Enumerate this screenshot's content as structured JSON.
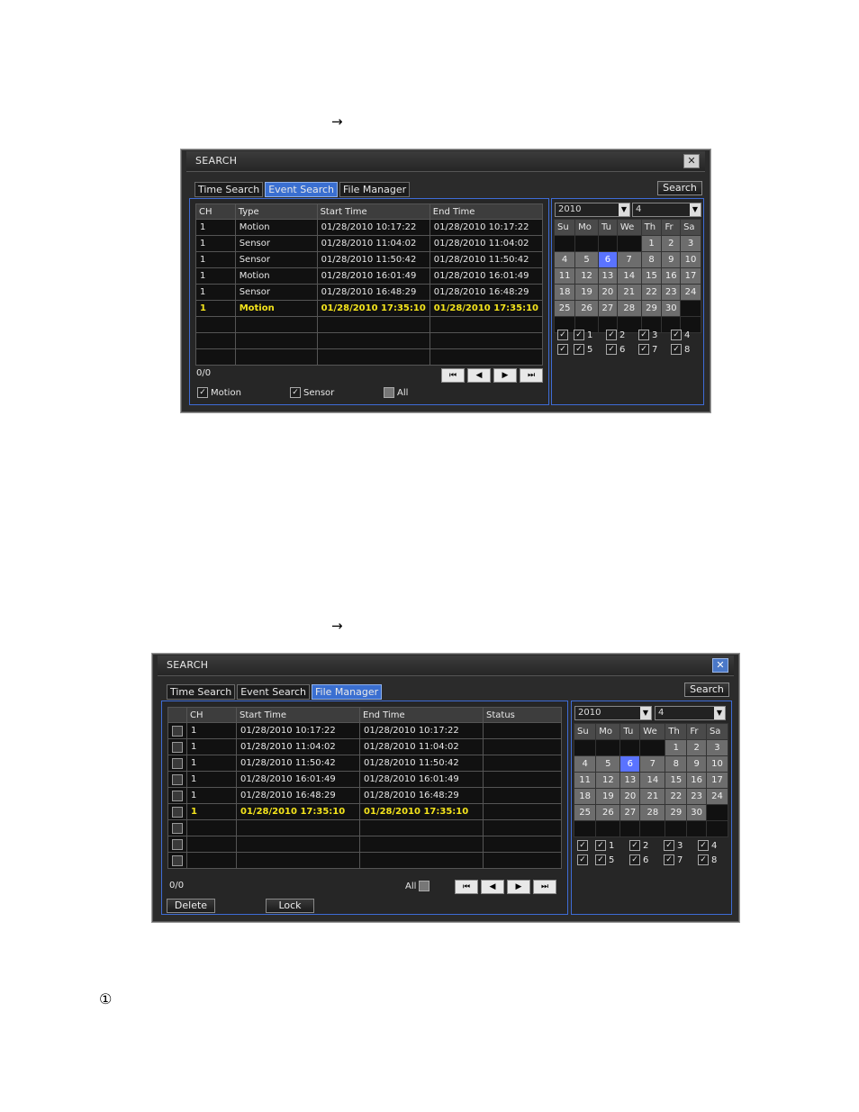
{
  "page": {
    "arrow_symbol": "→",
    "footnote_symbol": "①"
  },
  "event_window": {
    "title": "SEARCH",
    "close": "✕",
    "tabs": [
      "Time Search",
      "Event Search",
      "File Manager"
    ],
    "search_btn": "Search",
    "columns": [
      "CH",
      "Type",
      "Start Time",
      "End Time"
    ],
    "rows": [
      {
        "ch": "1",
        "type": "Motion",
        "start": "01/28/2010 10:17:22",
        "end": "01/28/2010 10:17:22"
      },
      {
        "ch": "1",
        "type": "Sensor",
        "start": "01/28/2010 11:04:02",
        "end": "01/28/2010 11:04:02"
      },
      {
        "ch": "1",
        "type": "Sensor",
        "start": "01/28/2010 11:50:42",
        "end": "01/28/2010 11:50:42"
      },
      {
        "ch": "1",
        "type": "Motion",
        "start": "01/28/2010 16:01:49",
        "end": "01/28/2010 16:01:49"
      },
      {
        "ch": "1",
        "type": "Sensor",
        "start": "01/28/2010 16:48:29",
        "end": "01/28/2010 16:48:29"
      },
      {
        "ch": "1",
        "type": "Motion",
        "start": "01/28/2010 17:35:10",
        "end": "01/28/2010 17:35:10"
      }
    ],
    "pager": "0/0",
    "filters": {
      "motion": "Motion",
      "sensor": "Sensor",
      "all": "All"
    },
    "year": "2010",
    "month": "4"
  },
  "file_window": {
    "title": "SEARCH",
    "close": "✕",
    "tabs": [
      "Time Search",
      "Event Search",
      "File Manager"
    ],
    "search_btn": "Search",
    "columns": [
      "CH",
      "Start Time",
      "End Time",
      "Status"
    ],
    "rows": [
      {
        "ch": "1",
        "start": "01/28/2010 10:17:22",
        "end": "01/28/2010 10:17:22"
      },
      {
        "ch": "1",
        "start": "01/28/2010 11:04:02",
        "end": "01/28/2010 11:04:02"
      },
      {
        "ch": "1",
        "start": "01/28/2010 11:50:42",
        "end": "01/28/2010 11:50:42"
      },
      {
        "ch": "1",
        "start": "01/28/2010 16:01:49",
        "end": "01/28/2010 16:01:49"
      },
      {
        "ch": "1",
        "start": "01/28/2010 16:48:29",
        "end": "01/28/2010 16:48:29"
      },
      {
        "ch": "1",
        "start": "01/28/2010 17:35:10",
        "end": "01/28/2010 17:35:10"
      }
    ],
    "pager": "0/0",
    "all_label": "All",
    "delete_btn": "Delete",
    "lock_btn": "Lock",
    "year": "2010",
    "month": "4"
  },
  "calendar": {
    "weekdays": [
      "Su",
      "Mo",
      "Tu",
      "We",
      "Th",
      "Fr",
      "Sa"
    ],
    "weeks": [
      [
        "",
        "",
        "",
        "",
        "1",
        "2",
        "3"
      ],
      [
        "4",
        "5",
        "6",
        "7",
        "8",
        "9",
        "10"
      ],
      [
        "11",
        "12",
        "13",
        "14",
        "15",
        "16",
        "17"
      ],
      [
        "18",
        "19",
        "20",
        "21",
        "22",
        "23",
        "24"
      ],
      [
        "25",
        "26",
        "27",
        "28",
        "29",
        "30",
        ""
      ],
      [
        "",
        "",
        "",
        "",
        "",
        "",
        ""
      ]
    ],
    "selected_day": "6",
    "channels": [
      "1",
      "2",
      "3",
      "4",
      "5",
      "6",
      "7",
      "8"
    ]
  },
  "pager_icons": [
    "⏮",
    "◀",
    "▶",
    "⏭"
  ],
  "colors": {
    "highlight_row": "#f4e41c",
    "active_tab": "#3a6fd1",
    "panel_border": "#3e6cd6",
    "selected_day": "#5a73ff"
  }
}
